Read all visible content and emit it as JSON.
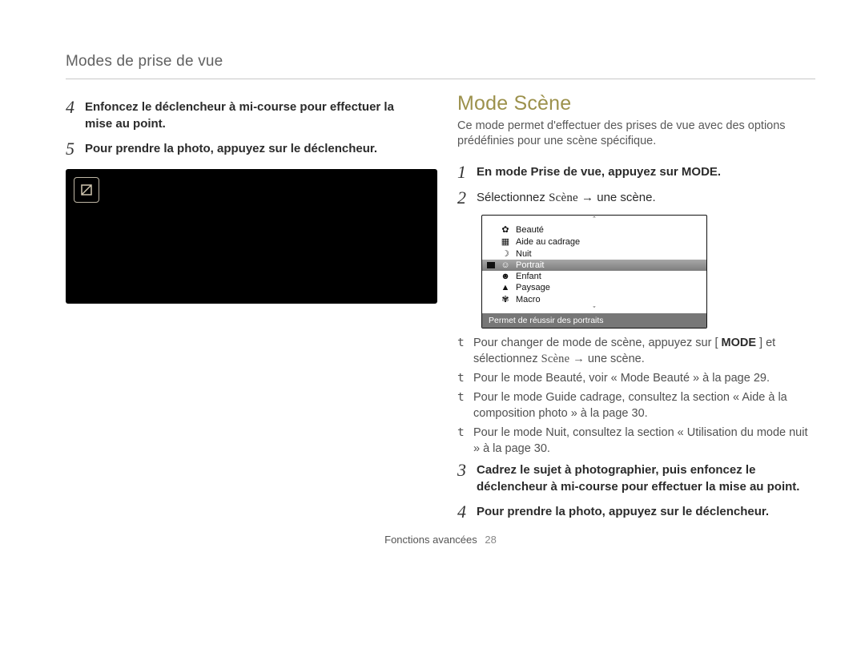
{
  "running_head": "Modes de prise de vue",
  "left": {
    "step4_num": "4",
    "step4_text": "Enfoncez le déclencheur à mi-course pour effectuer la mise au point.",
    "step5_num": "5",
    "step5_text": "Pour prendre la photo, appuyez sur le déclencheur."
  },
  "right": {
    "heading": "Mode Scène",
    "intro": "Ce mode permet d'effectuer des prises de vue avec des options prédéfinies pour une scène spécifique.",
    "step1_num": "1",
    "step1_text_a": "En mode Prise de vue, appuyez sur",
    "step1_mode": "MODE",
    "step1_text_b": ".",
    "step2_num": "2",
    "step2_text_a": "Sélectionnez ",
    "step2_scene_word": "Scène",
    "step2_text_b": " → une scène.",
    "scene_menu": {
      "items": [
        {
          "label": "Beauté"
        },
        {
          "label": "Aide au cadrage"
        },
        {
          "label": "Nuit"
        },
        {
          "label": "Portrait",
          "selected": true
        },
        {
          "label": "Enfant"
        },
        {
          "label": "Paysage"
        },
        {
          "label": "Macro"
        }
      ],
      "footer": "Permet de réussir des portraits"
    },
    "bullets": [
      {
        "pre": "Pour changer de mode de scène, appuyez sur [ ",
        "mode": "MODE",
        "post": " ] et sélectionnez ",
        "scene_word": "Scène",
        "tail": " → une scène."
      },
      {
        "text": "Pour le mode Beauté, voir « Mode Beauté » à la page 29."
      },
      {
        "text": "Pour le mode Guide cadrage, consultez la section « Aide à la composition photo » à la page 30."
      },
      {
        "text": "Pour le mode Nuit, consultez la section « Utilisation du mode nuit » à la page 30."
      }
    ],
    "step3_num": "3",
    "step3_text": "Cadrez le sujet à photographier, puis enfoncez le déclencheur à mi-course pour effectuer la mise au point.",
    "step4_num": "4",
    "step4_text": "Pour prendre la photo, appuyez sur le déclencheur."
  },
  "footer": {
    "section": "Fonctions avancées",
    "page": "28"
  },
  "icons": {
    "note": "note-icon"
  }
}
